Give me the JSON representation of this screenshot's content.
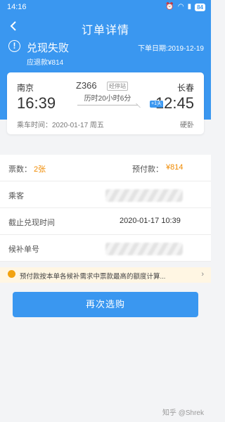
{
  "status_bar": {
    "time": "14:16",
    "battery": "84"
  },
  "nav": {
    "title": "订单详情"
  },
  "order": {
    "status": "兑现失败",
    "refund": "应退款¥814",
    "order_date": "下单日期:2019-12-19"
  },
  "ticket": {
    "from_city": "南京",
    "to_city": "长春",
    "dep_time": "16:39",
    "arr_time": "12:45",
    "train_no": "Z366",
    "train_tag": "经停站",
    "duration": "历时20小时6分",
    "day_badge": "+1天",
    "ride_time": "乘车时间：2020-01-17 周五",
    "seat_type": "硬卧"
  },
  "info_rows": {
    "ticket_count_label": "票数：",
    "ticket_count_value": "2张",
    "prepay_label": "预付款：",
    "prepay_value": "¥814",
    "passenger_label": "乘客",
    "deadline_label": "截止兑现时间",
    "deadline_value": "2020-01-17 10:39",
    "waitlist_label": "候补单号"
  },
  "notice": {
    "text": "预付款按本单各候补需求中票款最高的额度计算..."
  },
  "buttons": {
    "rebuy": "再次选购"
  },
  "watermark": "知乎 @Shrek",
  "colors": {
    "primary": "#3a97f0",
    "accent": "#f08a00"
  }
}
